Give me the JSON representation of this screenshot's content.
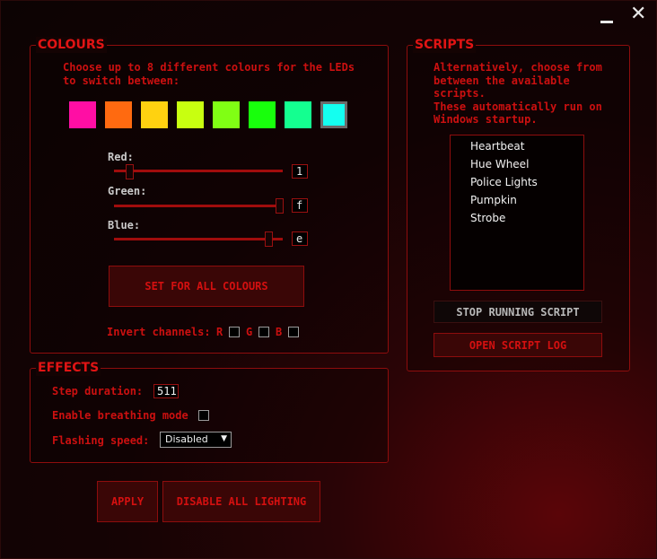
{
  "window": {
    "minimize_label": "_",
    "close_label": "✕"
  },
  "colours": {
    "title": "COLOURS",
    "instruction": "Choose up to 8 different colours for the LEDs\nto switch between:",
    "swatches": [
      "#ff0ea4",
      "#ff6a10",
      "#ffd210",
      "#c8ff10",
      "#80ff14",
      "#18ff0c",
      "#14ff90",
      "#14fff0"
    ],
    "selected_index": 7,
    "sliders": [
      {
        "label": "Red:",
        "value": "1",
        "level": 0.04
      },
      {
        "label": "Green:",
        "value": "f",
        "level": 1.0
      },
      {
        "label": "Blue:",
        "value": "e",
        "level": 0.93
      }
    ],
    "set_all_label": "SET FOR ALL COLOURS",
    "invert_label": "Invert channels:",
    "invert_channels": [
      "R",
      "G",
      "B"
    ]
  },
  "scripts": {
    "title": "SCRIPTS",
    "instruction": "Alternatively, choose from\nbetween the available\nscripts.\nThese automatically run on\nWindows startup.",
    "items": [
      "Heartbeat",
      "Hue Wheel",
      "Police Lights",
      "Pumpkin",
      "Strobe"
    ],
    "stop_label": "STOP RUNNING SCRIPT",
    "log_label": "OPEN SCRIPT LOG"
  },
  "effects": {
    "title": "EFFECTS",
    "step_duration_label": "Step duration:",
    "step_duration_value": "511",
    "breathing_label": "Enable breathing mode",
    "flashing_label": "Flashing speed:",
    "flashing_value": "Disabled"
  },
  "actions": {
    "apply_label": "APPLY",
    "disable_label": "DISABLE ALL LIGHTING"
  }
}
